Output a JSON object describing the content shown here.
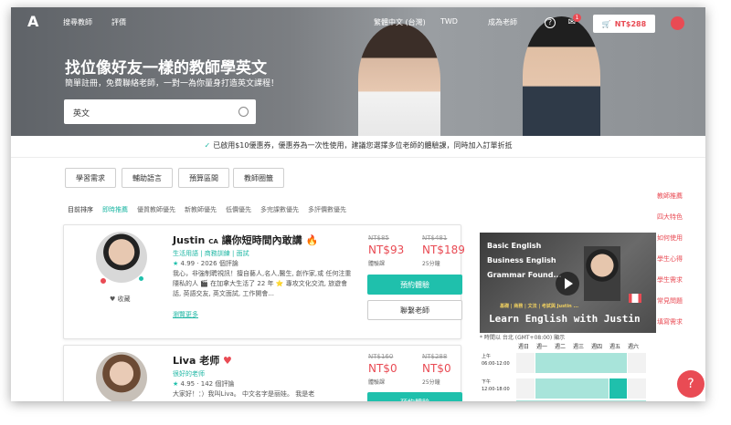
{
  "nav": {
    "logo": "A",
    "link1": "搜尋教師",
    "link2": "評價",
    "lang": "繁體中文 (台灣)",
    "currency": "TWD",
    "become_teacher": "成為老師",
    "help": "?",
    "cart_count": "1",
    "cart_price": "NT$288"
  },
  "hero": {
    "title": "找位像好友一樣的教師學英文",
    "subtitle": "簡單註冊，免費聯絡老師，一對一為你量身打造英文課程！",
    "search_value": "英文"
  },
  "promo": {
    "check": "✓",
    "text": "已啟用$10優惠券，優惠券為一次性使用，建議您選擇多位老師的體驗課，同時加入訂單折抵"
  },
  "filters": [
    "學習需求",
    "輔助語言",
    "預算區間",
    "教師圈籤"
  ],
  "sort": {
    "label": "目前排序",
    "options": [
      "即時推薦",
      "優質教師優先",
      "新教師優先",
      "低價優先",
      "多完課數優先",
      "多評價數優先"
    ]
  },
  "teachers": [
    {
      "name": "Justin",
      "flag": "CA",
      "tagline": "讓你短時間內敢講",
      "badge": "🔥",
      "tags": "生活用語 | 商務訓練 | 面試",
      "rating": "4.99 · 2026 個評論",
      "desc": "我心，非強制聘視訊！擅自藝人,名人,醫生, 創作家,或 任何注重隱私的人 🎬 在加拿大生活了 22 年 ⭐ 專攻文化交流, 旅遊會話, 英語交友, 英文面試, 工作開會...",
      "more": "瀏覽更多",
      "collect": "收藏",
      "p1_old": "NT$85",
      "p1_new": "NT$93",
      "p1_lbl": "體驗課",
      "p2_old": "NT$481",
      "p2_new": "NT$189",
      "p2_lbl": "25分鐘",
      "btn_book": "預約體驗",
      "btn_contact": "聯繫老師"
    },
    {
      "name": "Liva 老师",
      "badge": "♥",
      "tags": "很好的老师",
      "rating": "4.95 · 142 個評論",
      "desc": "大家好！：）我叫Liva。 中文名字是丽娃。 我是老",
      "p1_old": "NT$160",
      "p1_new": "NT$0",
      "p1_lbl": "體驗課",
      "p2_old": "NT$288",
      "p2_new": "NT$0",
      "p2_lbl": "25分鐘",
      "btn_book": "預約體驗"
    }
  ],
  "video": {
    "line1": "Basic English",
    "line2": "Business English",
    "line3": "Grammar Found...",
    "line4": "Learn English with Justin",
    "note": "基礎 | 商務 | 文法 | 考試與 Justin ...",
    "tz": "* 時間以 台北 (GMT+08:00) 顯示"
  },
  "calendar": {
    "days": [
      "週日",
      "週一",
      "週二",
      "週三",
      "週四",
      "週五",
      "週六"
    ],
    "row1a": "上午",
    "row1b": "06:00-12:00",
    "row2a": "下午",
    "row2b": "12:00-18:00"
  },
  "sidebar": [
    "教師推薦",
    "四大特色",
    "如何使用",
    "學生心得",
    "學生需求",
    "常見問題",
    "填寫需求"
  ],
  "fab": "?",
  "colors": {
    "accent": "#e94b54",
    "teal": "#1fc0ac"
  }
}
